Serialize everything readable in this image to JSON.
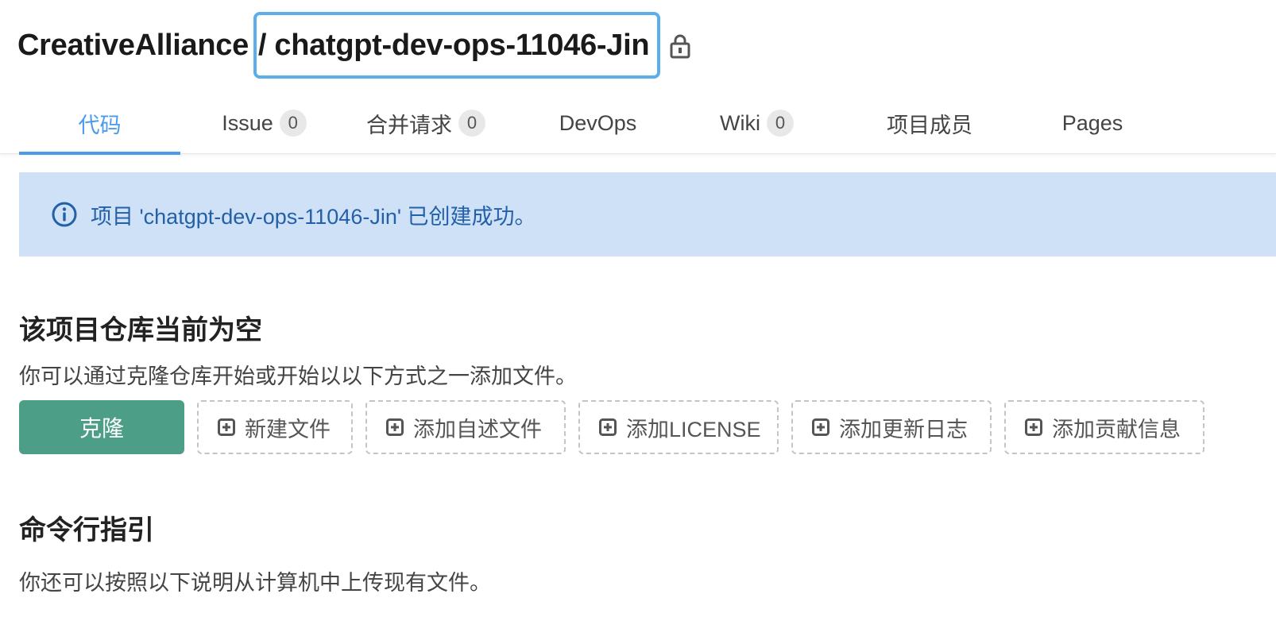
{
  "header": {
    "org": "CreativeAlliance",
    "repo_name": "/ chatgpt-dev-ops-11046-Jin",
    "lock_icon": "lock-icon"
  },
  "tabs": [
    {
      "label": "代码",
      "active": true
    },
    {
      "label": "Issue",
      "count": "0"
    },
    {
      "label": "合并请求",
      "count": "0"
    },
    {
      "label": "DevOps"
    },
    {
      "label": "Wiki",
      "count": "0"
    },
    {
      "label": "项目成员"
    },
    {
      "label": "Pages"
    }
  ],
  "alert": {
    "icon": "info-icon",
    "message": "项目 'chatgpt-dev-ops-11046-Jin' 已创建成功。"
  },
  "empty_repo": {
    "title": "该项目仓库当前为空",
    "description": "你可以通过克隆仓库开始或开始以以下方式之一添加文件。",
    "clone_label": "克隆",
    "actions": [
      {
        "label": "新建文件",
        "icon": "plus-square-icon"
      },
      {
        "label": "添加自述文件",
        "icon": "plus-square-icon"
      },
      {
        "label": "添加LICENSE",
        "icon": "plus-square-icon"
      },
      {
        "label": "添加更新日志",
        "icon": "plus-square-icon"
      },
      {
        "label": "添加贡献信息",
        "icon": "plus-square-icon"
      }
    ]
  },
  "cli_guide": {
    "title": "命令行指引",
    "description": "你还可以按照以下说明从计算机中上传现有文件。"
  },
  "colors": {
    "accent": "#4a9bea",
    "clone_button": "#4c9e87",
    "alert_bg": "#cfe1f6",
    "alert_text": "#2360a8",
    "highlight_border": "#5aaeec"
  }
}
